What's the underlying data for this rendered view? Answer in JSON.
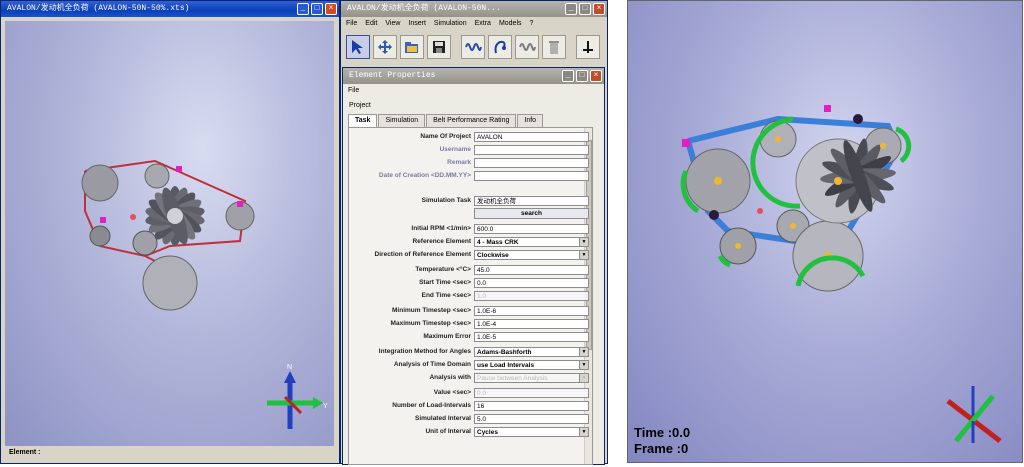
{
  "left_window": {
    "title": "AVALON/发动机全负荷 (AVALON-50N-50%.xts)",
    "status_label": "Element :"
  },
  "main_window": {
    "title": "AVALON/发动机全负荷 (AVALON-50N...",
    "menu": [
      "File",
      "Edit",
      "View",
      "Insert",
      "Simulation",
      "Extra",
      "Models",
      "?"
    ]
  },
  "element_properties": {
    "title": "Element Properties",
    "menu": [
      "File"
    ],
    "project_label": "Project",
    "tabs": [
      "Task",
      "Simulation",
      "Belt Performance Rating",
      "Info"
    ],
    "fields": [
      {
        "label": "Name Of Project",
        "value": "AVALON",
        "kind": "text"
      },
      {
        "label": "Username",
        "value": "",
        "kind": "text",
        "muted": true
      },
      {
        "label": "Remark",
        "value": "",
        "kind": "text",
        "muted": true
      },
      {
        "label": "Date of Creation <DD.MM.YY>",
        "value": "",
        "kind": "text",
        "muted": true
      },
      {
        "label": "Simulation Task",
        "value": "发动机全负荷",
        "kind": "text"
      },
      {
        "label": "",
        "value": "search",
        "kind": "button"
      },
      {
        "label": "Initial RPM <1/min>",
        "value": "600.0",
        "kind": "text"
      },
      {
        "label": "Reference Element",
        "value": "4 - Mass CRK",
        "kind": "select"
      },
      {
        "label": "Direction of Reference Element",
        "value": "Clockwise",
        "kind": "select"
      },
      {
        "label": "Temperature <°C>",
        "value": "45.0",
        "kind": "text"
      },
      {
        "label": "Start Time <sec>",
        "value": "0.0",
        "kind": "text"
      },
      {
        "label": "End Time <sec>",
        "value": "1.0",
        "kind": "text",
        "disabled": true
      },
      {
        "label": "Minimum Timestep <sec>",
        "value": "1.0E-6",
        "kind": "text"
      },
      {
        "label": "Maximum Timestep <sec>",
        "value": "1.0E-4",
        "kind": "text"
      },
      {
        "label": "Maximum Error",
        "value": "1.0E-5",
        "kind": "text"
      },
      {
        "label": "Integration Method for Angles",
        "value": "Adams-Bashforth",
        "kind": "select"
      },
      {
        "label": "Analysis of Time Domain",
        "value": "use Load Intervals",
        "kind": "select"
      },
      {
        "label": "Analysis with",
        "value": "Pause between Analysis",
        "kind": "select",
        "disabled": true
      },
      {
        "label": "Value <sec>",
        "value": "0.0",
        "kind": "text",
        "disabled": true
      },
      {
        "label": "Number of Load-Intervals",
        "value": "16",
        "kind": "text"
      },
      {
        "label": "Simulated Interval",
        "value": "5.0",
        "kind": "text"
      },
      {
        "label": "Unit of Interval",
        "value": "Cycles",
        "kind": "select"
      }
    ]
  },
  "right_view": {
    "time_label": "Time :0.0",
    "frame_label": "Frame :0"
  },
  "axis_labels": {
    "n": "N",
    "y": "Y"
  },
  "icons": [
    "arrow-select-icon",
    "move-icon",
    "open-folder-icon",
    "save-icon",
    "spring-icon",
    "belt-icon",
    "spring-icon-2",
    "trash-icon",
    "axis-tool-icon"
  ],
  "colors": {
    "titlebar": "#0b3fb3",
    "belt_red": "#c0303a",
    "belt_blue": "#3a7fd8",
    "tensioner_green": "#22c040",
    "magenta": "#e020c0"
  }
}
